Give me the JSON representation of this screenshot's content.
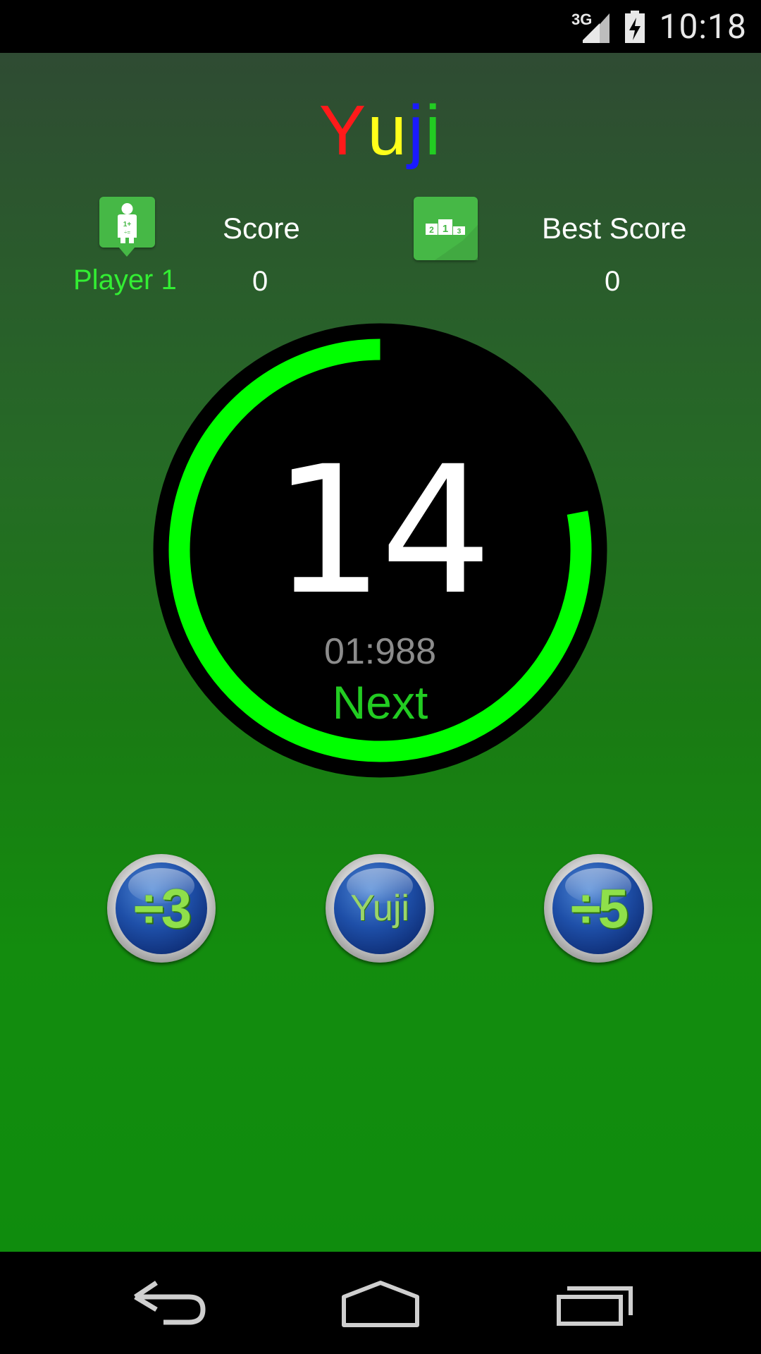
{
  "status_bar": {
    "network": "3G",
    "clock": "10:18",
    "icons": [
      "signal-icon",
      "battery-charging-icon"
    ]
  },
  "app": {
    "title_letters": [
      {
        "char": "Y",
        "color": "#ff1a1a"
      },
      {
        "char": "u",
        "color": "#ffff1a"
      },
      {
        "char": "j",
        "color": "#1a1aff"
      },
      {
        "char": "i",
        "color": "#22cc22"
      }
    ]
  },
  "scoreboard": {
    "player_label": "Player 1",
    "score_label": "Score",
    "score_value": "0",
    "best_score_label": "Best Score",
    "best_score_value": "0",
    "icons": {
      "player": "player-card-icon",
      "ranking": "podium-icon"
    }
  },
  "timer": {
    "number": "14",
    "time_left": "01:988",
    "next_label": "Next",
    "progress_fraction": 0.78,
    "ring_color": "#00ff00"
  },
  "buttons": [
    {
      "id": "div3",
      "label": "÷3"
    },
    {
      "id": "yuji",
      "label": "Yuji"
    },
    {
      "id": "div5",
      "label": "÷5"
    }
  ],
  "nav": {
    "icons": [
      "back-icon",
      "home-icon",
      "recent-apps-icon"
    ]
  }
}
